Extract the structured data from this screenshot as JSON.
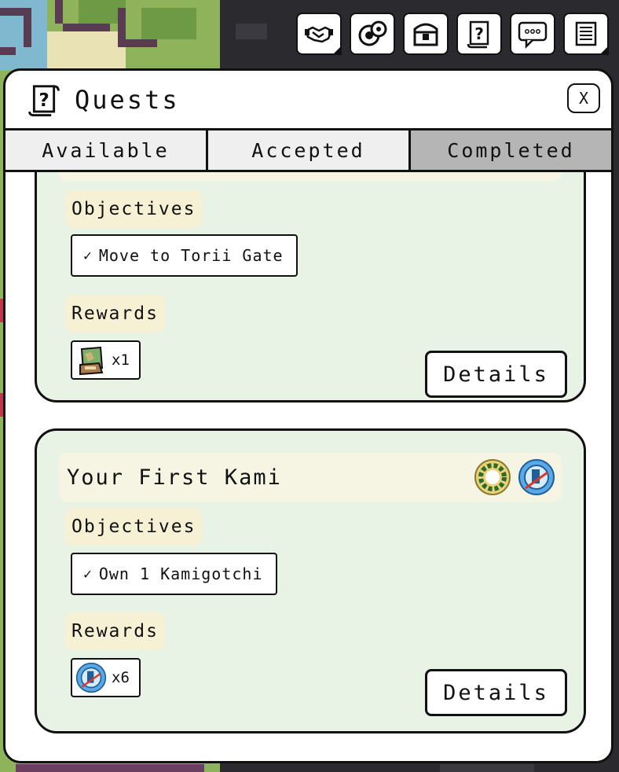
{
  "toolbar": {
    "buttons": [
      {
        "icon": "handshake-icon"
      },
      {
        "icon": "settings-icon"
      },
      {
        "icon": "chest-icon"
      },
      {
        "icon": "quest-scroll-icon"
      },
      {
        "icon": "chat-icon"
      },
      {
        "icon": "menu-icon"
      }
    ]
  },
  "modal": {
    "title": "Quests",
    "close_label": "X",
    "header_icon": "quest-scroll-icon"
  },
  "tabs": [
    {
      "label": "Available",
      "active": false
    },
    {
      "label": "Accepted",
      "active": false
    },
    {
      "label": "Completed",
      "active": true
    }
  ],
  "quests": [
    {
      "title": "",
      "objectives_label": "Objectives",
      "objectives": [
        {
          "check": "✓",
          "text": "Move to Torii Gate"
        }
      ],
      "rewards_label": "Rewards",
      "rewards": [
        {
          "icon": "map-item-icon",
          "qty": "x1"
        }
      ],
      "details_label": "Details"
    },
    {
      "title": "Your First Kami",
      "badges": [
        "laurel-badge-icon",
        "kami-token-icon"
      ],
      "objectives_label": "Objectives",
      "objectives": [
        {
          "check": "✓",
          "text": "Own 1 Kamigotchi"
        }
      ],
      "rewards_label": "Rewards",
      "rewards": [
        {
          "icon": "kami-token-icon",
          "qty": "x6"
        }
      ],
      "details_label": "Details"
    }
  ],
  "colors": {
    "card_bg": "#e8f3e6",
    "title_bar_bg": "#f6f5e3",
    "label_bg": "#f6f1d4",
    "active_tab": "#b5b5b5",
    "inactive_tab": "#efefef"
  }
}
